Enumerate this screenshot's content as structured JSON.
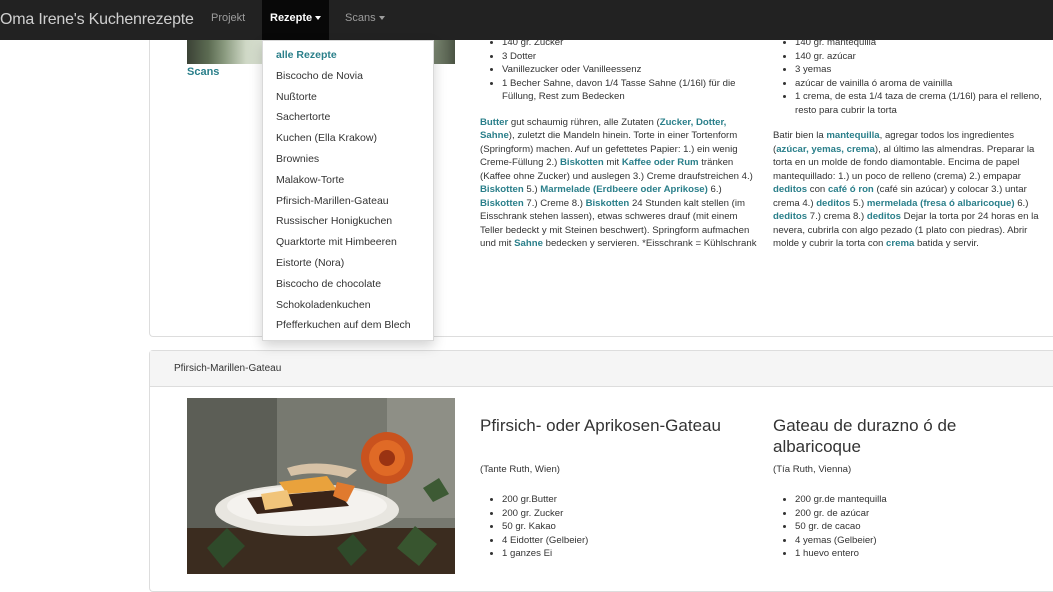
{
  "navbar": {
    "brand": "Oma Irene's Kuchenrezepte",
    "items": [
      {
        "label": "Projekt"
      },
      {
        "label": "Rezepte"
      },
      {
        "label": "Scans"
      }
    ]
  },
  "dropdown": {
    "items": [
      "alle Rezepte",
      "Biscocho de Novia",
      "Nußtorte",
      "Sachertorte",
      "Kuchen (Ella Krakow)",
      "Brownies",
      "Malakow-Torte",
      "Pfirsich-Marillen-Gateau",
      "Russischer Honigkuchen",
      "Quarktorte mit Himbeeren",
      "Eistorte (Nora)",
      "Biscocho de chocolate",
      "Schokoladenkuchen",
      "Pfefferkuchen auf dem Blech"
    ]
  },
  "sidebar": {
    "scans": "Scans"
  },
  "recipe1": {
    "de": {
      "ingredients": [
        "140 gr. Zucker",
        "3 Dotter",
        "Vanillezucker oder Vanilleessenz",
        "1 Becher Sahne, davon 1/4 Tasse Sahne (1/16l) für die Füllung, Rest zum Bedecken"
      ],
      "steps": [
        {
          "t": "Butter",
          "k": true
        },
        {
          "t": " gut schaumig rühren, alle Zutaten ("
        },
        {
          "t": "Zucker, Dotter, Sahne",
          "k": true
        },
        {
          "t": "), zuletzt die Mandeln hinein. Torte in einer Tortenform (Springform) machen. Auf un gefettetes Papier: 1.) ein wenig Creme-Füllung 2.) "
        },
        {
          "t": "Biskotten",
          "k": true
        },
        {
          "t": " mit "
        },
        {
          "t": "Kaffee oder Rum",
          "k": true
        },
        {
          "t": " tränken (Kaffee ohne Zucker) und auslegen 3.) Creme draufstreichen 4.) "
        },
        {
          "t": "Biskotten",
          "k": true
        },
        {
          "t": " 5.) "
        },
        {
          "t": "Marmelade (Erdbeere oder Aprikose)",
          "k": true
        },
        {
          "t": " 6.) "
        },
        {
          "t": "Biskotten",
          "k": true
        },
        {
          "t": " 7.) Creme 8.) "
        },
        {
          "t": "Biskotten",
          "k": true
        },
        {
          "t": " 24 Stunden kalt stellen (im Eisschrank stehen lassen), etwas schweres drauf (mit einem Teller bedeckt y mit Steinen beschwert). Springform aufmachen und mit "
        },
        {
          "t": "Sahne",
          "k": true
        },
        {
          "t": " bedecken y servieren. *Eisschrank = Kühlschrank"
        }
      ]
    },
    "es": {
      "ingredients": [
        "140 gr. mantequilla",
        "140 gr. azúcar",
        "3 yemas",
        "azúcar de vainilla ó aroma de vainilla",
        "1 crema, de esta 1/4 taza de crema (1/16l) para el relleno, resto para cubrir la torta"
      ],
      "steps": [
        {
          "t": "Batir bien la "
        },
        {
          "t": "mantequilla",
          "k": true
        },
        {
          "t": ", agregar todos los ingredientes ("
        },
        {
          "t": "azúcar, yemas, crema",
          "k": true
        },
        {
          "t": "), al último las almendras. Preparar la torta en un molde de fondo diamontable. Encima de papel mantequillado: 1.) un poco de relleno (crema) 2.) empapar "
        },
        {
          "t": "deditos",
          "k": true
        },
        {
          "t": " con "
        },
        {
          "t": "café ó ron",
          "k": true
        },
        {
          "t": " (café sin azúcar) y colocar 3.) untar crema 4.) "
        },
        {
          "t": "deditos",
          "k": true
        },
        {
          "t": " 5.) "
        },
        {
          "t": "mermelada (fresa ó albaricoque)",
          "k": true
        },
        {
          "t": " 6.) "
        },
        {
          "t": "deditos",
          "k": true
        },
        {
          "t": " 7.) crema 8.) "
        },
        {
          "t": "deditos",
          "k": true
        },
        {
          "t": " Dejar la torta por 24 horas en la nevera, cubrirla con algo pezado (1 plato con piedras). Abrir molde y cubrir la torta con "
        },
        {
          "t": "crema",
          "k": true
        },
        {
          "t": " batida y servir."
        }
      ]
    }
  },
  "recipe2": {
    "heading": "Pfirsich-Marillen-Gateau",
    "de": {
      "title": "Pfirsich- oder Aprikosen-Gateau",
      "source": "(Tante Ruth, Wien)",
      "ingredients": [
        "200 gr.Butter",
        "200 gr. Zucker",
        "50 gr. Kakao",
        "4 Eidotter (Gelbeier)",
        "1 ganzes Ei"
      ]
    },
    "es": {
      "title": "Gateau de durazno ó de albaricoque",
      "source": "(Tía Ruth, Vienna)",
      "ingredients": [
        "200 gr.de mantequilla",
        "200 gr. de azúcar",
        "50 gr. de cacao",
        "4 yemas (Gelbeier)",
        "1 huevo entero"
      ]
    }
  },
  "colors": {
    "accent": "#2a7f8a",
    "navbar": "#222222"
  }
}
